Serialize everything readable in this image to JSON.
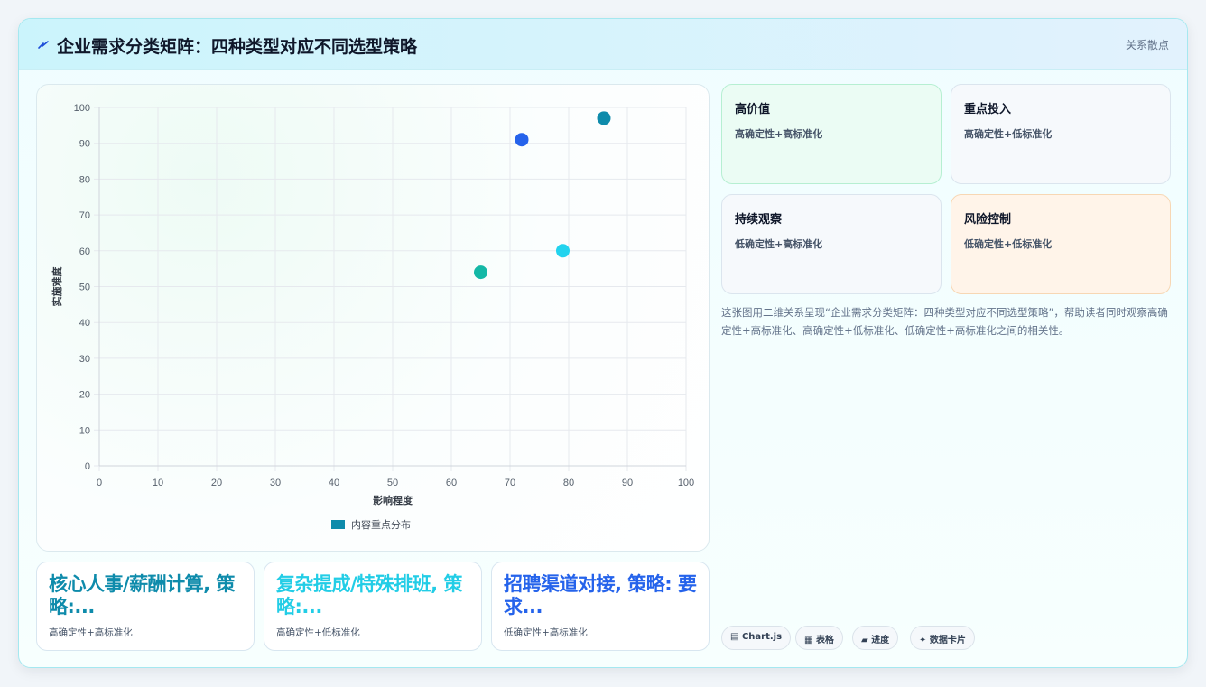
{
  "header": {
    "title": "企业需求分类矩阵：四种类型对应不同选型策略",
    "tag": "关系散点",
    "accent": "#1d4ed8"
  },
  "chart_data": {
    "type": "scatter",
    "xlabel": "影响程度",
    "ylabel": "实施难度",
    "xlim": [
      0,
      100
    ],
    "ylim": [
      0,
      100
    ],
    "xticks": [
      0,
      10,
      20,
      30,
      40,
      50,
      60,
      70,
      80,
      90,
      100
    ],
    "yticks": [
      0,
      10,
      20,
      30,
      40,
      50,
      60,
      70,
      80,
      90,
      100
    ],
    "grid": true,
    "legend_position": "bottom",
    "series": [
      {
        "name": "内容重点分布",
        "color": "#0e8bab",
        "points": [
          {
            "x": 72,
            "y": 91,
            "color": "#2563eb"
          },
          {
            "x": 86,
            "y": 97,
            "color": "#0e8bab"
          },
          {
            "x": 79,
            "y": 60,
            "color": "#22d3ee"
          },
          {
            "x": 65,
            "y": 54,
            "color": "#14b8a6"
          }
        ]
      }
    ]
  },
  "quadrants": [
    {
      "title": "高价值",
      "subtitle": "高确定性+高标准化"
    },
    {
      "title": "重点投入",
      "subtitle": "高确定性+低标准化"
    },
    {
      "title": "持续观察",
      "subtitle": "低确定性+高标准化"
    },
    {
      "title": "风险控制",
      "subtitle": "低确定性+低标准化"
    }
  ],
  "description": "这张图用二维关系呈现“企业需求分类矩阵：四种类型对应不同选型策略”，帮助读者同时观察高确定性+高标准化、高确定性+低标准化、低确定性+高标准化之间的相关性。",
  "tiles": [
    {
      "headline": "核心人事/薪酬计算, 策略:...",
      "sub": "高确定性+高标准化"
    },
    {
      "headline": "复杂提成/特殊排班, 策略:...",
      "sub": "高确定性+低标准化"
    },
    {
      "headline": "招聘渠道对接, 策略: 要求...",
      "sub": "低确定性+高标准化"
    }
  ],
  "pills": [
    {
      "icon": "chart-icon",
      "label": "Chart.js"
    },
    {
      "icon": "table-icon",
      "label": "表格"
    },
    {
      "icon": "progress-icon",
      "label": "进度"
    },
    {
      "icon": "sparkle-icon",
      "label": "数据卡片"
    }
  ]
}
